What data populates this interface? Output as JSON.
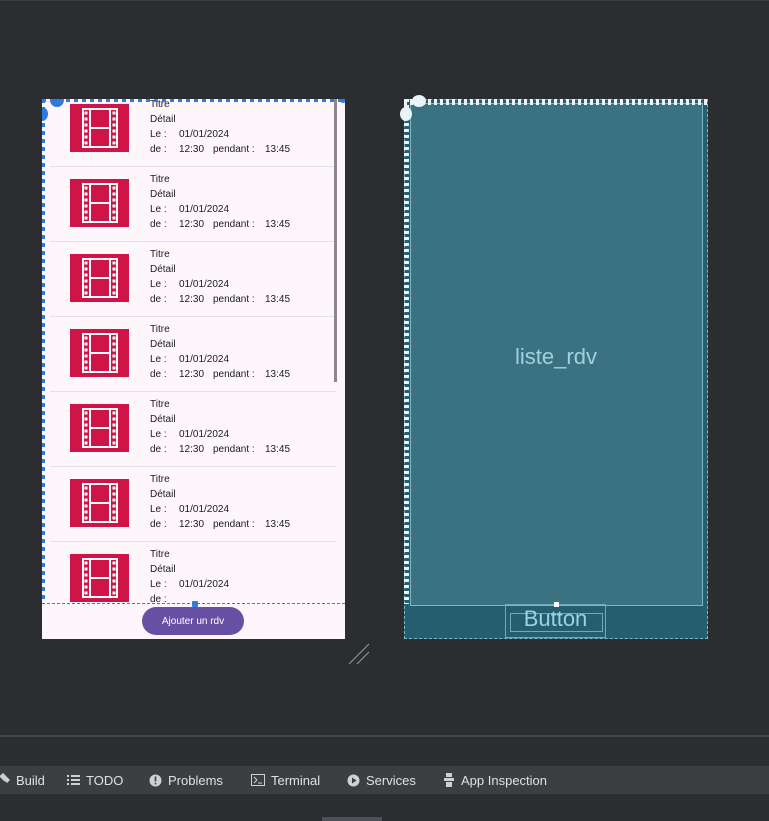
{
  "preview": {
    "items": [
      {
        "title": "Titre",
        "detail": "Détail",
        "le_label": "Le :",
        "date": "01/01/2024",
        "de_label": "de :",
        "start": "12:30",
        "pendant_label": "pendant :",
        "duration": "13:45"
      },
      {
        "title": "Titre",
        "detail": "Détail",
        "le_label": "Le :",
        "date": "01/01/2024",
        "de_label": "de :",
        "start": "12:30",
        "pendant_label": "pendant :",
        "duration": "13:45"
      },
      {
        "title": "Titre",
        "detail": "Détail",
        "le_label": "Le :",
        "date": "01/01/2024",
        "de_label": "de :",
        "start": "12:30",
        "pendant_label": "pendant :",
        "duration": "13:45"
      },
      {
        "title": "Titre",
        "detail": "Détail",
        "le_label": "Le :",
        "date": "01/01/2024",
        "de_label": "de :",
        "start": "12:30",
        "pendant_label": "pendant :",
        "duration": "13:45"
      },
      {
        "title": "Titre",
        "detail": "Détail",
        "le_label": "Le :",
        "date": "01/01/2024",
        "de_label": "de :",
        "start": "12:30",
        "pendant_label": "pendant :",
        "duration": "13:45"
      },
      {
        "title": "Titre",
        "detail": "Détail",
        "le_label": "Le :",
        "date": "01/01/2024",
        "de_label": "de :",
        "start": "12:30",
        "pendant_label": "pendant :",
        "duration": "13:45"
      },
      {
        "title": "Titre",
        "detail": "Détail",
        "le_label": "Le :",
        "date": "01/01/2024",
        "de_label": "de :",
        "start": "",
        "pendant_label": "",
        "duration": ""
      }
    ],
    "fab_label": "Ajouter un rdv",
    "thumbnail_icon": "film-strip-icon"
  },
  "blueprint": {
    "list_label": "liste_rdv",
    "button_label": "Button"
  },
  "toolwindows": [
    {
      "label": "Build",
      "icon": "hammer-icon"
    },
    {
      "label": "TODO",
      "icon": "list-icon"
    },
    {
      "label": "Problems",
      "icon": "warning-icon"
    },
    {
      "label": "Terminal",
      "icon": "terminal-icon"
    },
    {
      "label": "Services",
      "icon": "play-icon"
    },
    {
      "label": "App Inspection",
      "icon": "inspection-icon"
    }
  ],
  "colors": {
    "thumbnail": "#cf1447",
    "fab": "#6750a4",
    "blueprint": "#255e6e",
    "selection": "#2d7be0"
  }
}
